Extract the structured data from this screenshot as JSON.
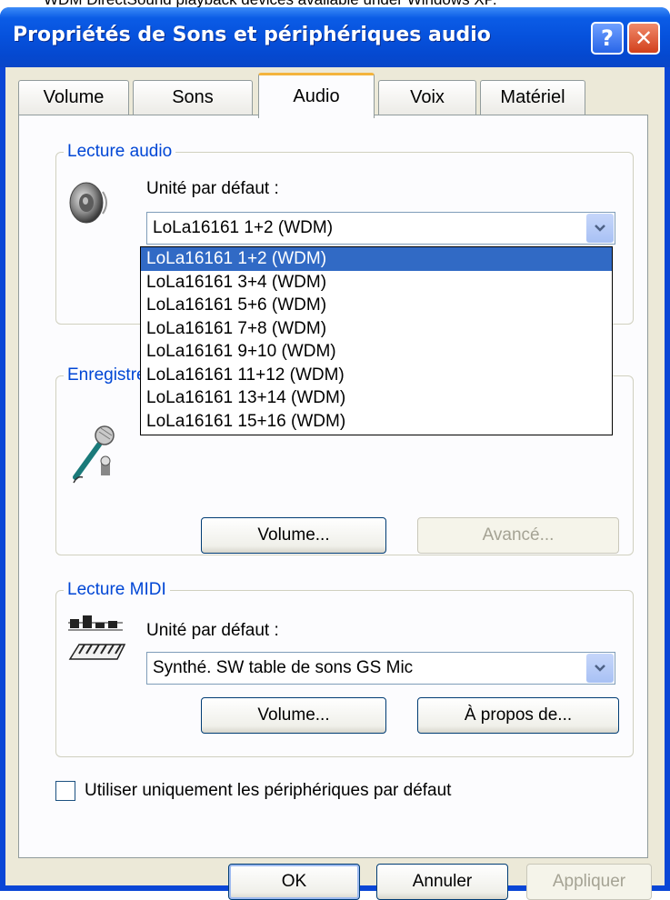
{
  "caption": "WDM DirectSound playback devices available under Windows XP.",
  "window": {
    "title": "Propriétés de Sons et périphériques audio",
    "help_label": "?",
    "close_label": "✕"
  },
  "tabs": [
    {
      "label": "Volume"
    },
    {
      "label": "Sons"
    },
    {
      "label": "Audio"
    },
    {
      "label": "Voix"
    },
    {
      "label": "Matériel"
    }
  ],
  "audio_playback": {
    "group_label": "Lecture audio",
    "default_device_label": "Unité par défaut :",
    "selected_device": "LoLa16161 1+2 (WDM)",
    "options": [
      "LoLa16161 1+2 (WDM)",
      "LoLa16161 3+4 (WDM)",
      "LoLa16161 5+6 (WDM)",
      "LoLa16161 7+8 (WDM)",
      "LoLa16161 9+10 (WDM)",
      "LoLa16161 11+12 (WDM)",
      "LoLa16161 13+14 (WDM)",
      "LoLa16161 15+16 (WDM)"
    ]
  },
  "recording": {
    "group_label": "Enregistrement audio",
    "volume_button": "Volume...",
    "advanced_button": "Avancé..."
  },
  "midi": {
    "group_label": "Lecture MIDI",
    "default_device_label": "Unité par défaut :",
    "selected_device": "Synthé. SW table de sons GS Mic",
    "volume_button": "Volume...",
    "about_button": "À propos de..."
  },
  "default_only_checkbox": {
    "label": "Utiliser uniquement les périphériques par défaut",
    "checked": false
  },
  "footer": {
    "ok": "OK",
    "cancel": "Annuler",
    "apply": "Appliquer"
  },
  "colors": {
    "titlebar": "#0651dc",
    "dialog_bg": "#ece9d8",
    "group_label": "#0046d5",
    "selection": "#316ac5"
  }
}
